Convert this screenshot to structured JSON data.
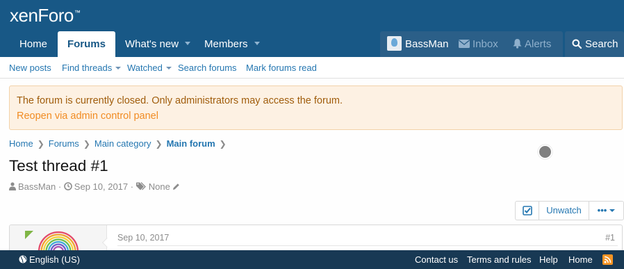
{
  "header": {
    "logo": "xenForo",
    "logo_tm": "™"
  },
  "nav": {
    "tabs": [
      {
        "label": "Home"
      },
      {
        "label": "Forums"
      },
      {
        "label": "What's new"
      },
      {
        "label": "Members"
      }
    ],
    "active_tab": "Forums",
    "user": {
      "name": "BassMan"
    },
    "inbox_label": "Inbox",
    "alerts_label": "Alerts",
    "search_label": "Search"
  },
  "subnav": {
    "items": [
      {
        "label": "New posts"
      },
      {
        "label": "Find threads"
      },
      {
        "label": "Watched"
      },
      {
        "label": "Search forums"
      },
      {
        "label": "Mark forums read"
      }
    ]
  },
  "notice": {
    "message": "The forum is currently closed. Only administrators may access the forum.",
    "link": "Reopen via admin control panel"
  },
  "breadcrumb": {
    "items": [
      {
        "label": "Home"
      },
      {
        "label": "Forums"
      },
      {
        "label": "Main category"
      },
      {
        "label": "Main forum"
      }
    ]
  },
  "thread": {
    "title": "Test thread #1",
    "author": "BassMan",
    "date": "Sep 10, 2017",
    "tags": "None",
    "meta_sep": "·"
  },
  "actions": {
    "unwatch_label": "Unwatch",
    "more_label": "•••"
  },
  "post": {
    "date": "Sep 10, 2017",
    "number": "#1"
  },
  "footer": {
    "language": "English (US)",
    "links": [
      {
        "label": "Contact us"
      },
      {
        "label": "Terms and rules"
      },
      {
        "label": "Help"
      },
      {
        "label": "Home"
      }
    ]
  },
  "colors": {
    "header_bg": "#185886",
    "link": "#2577b1",
    "notice_bg": "#fdf1e3",
    "notice_text": "#a05d0c",
    "notice_link": "#f18c23",
    "footer_bg": "#183954",
    "rss": "#f59424"
  }
}
